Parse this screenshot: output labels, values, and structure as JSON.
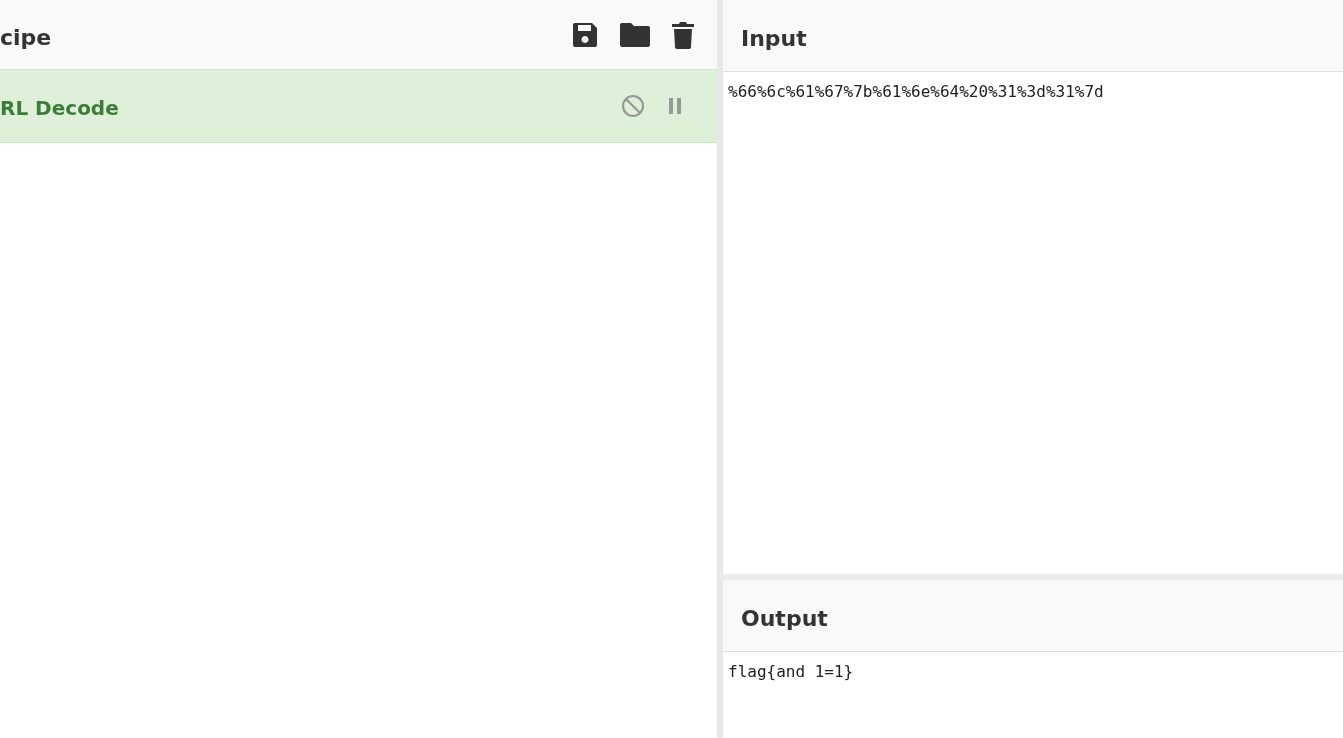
{
  "recipe": {
    "title": "cipe",
    "operations": [
      {
        "name": "RL Decode"
      }
    ]
  },
  "input": {
    "title": "Input",
    "value": "%66%6c%61%67%7b%61%6e%64%20%31%3d%31%7d"
  },
  "output": {
    "title": "Output",
    "value": "flag{and 1=1}"
  }
}
